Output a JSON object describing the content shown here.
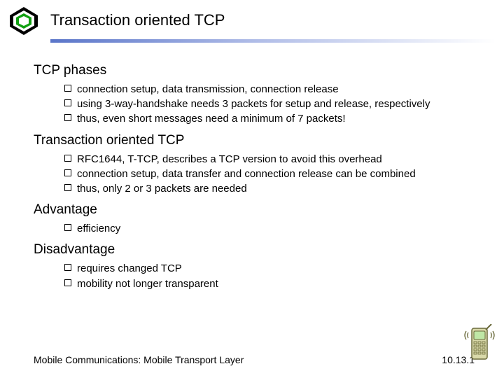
{
  "header": {
    "title": "Transaction oriented TCP"
  },
  "sections": [
    {
      "heading": "TCP phases",
      "bullets": [
        "connection setup, data transmission, connection release",
        "using 3-way-handshake needs 3 packets for setup and release, respectively",
        "thus, even short messages need a minimum of 7 packets!"
      ]
    },
    {
      "heading": "Transaction oriented TCP",
      "bullets": [
        "RFC1644, T-TCP, describes a TCP version to avoid this overhead",
        "connection setup, data transfer and connection release can be combined",
        "thus, only 2 or 3 packets are needed"
      ]
    },
    {
      "heading": "Advantage",
      "bullets": [
        "efficiency"
      ]
    },
    {
      "heading": "Disadvantage",
      "bullets": [
        "requires changed TCP",
        "mobility not longer transparent"
      ]
    }
  ],
  "footer": {
    "left": "Mobile Communications: Mobile Transport Layer",
    "right": "10.13.1"
  }
}
